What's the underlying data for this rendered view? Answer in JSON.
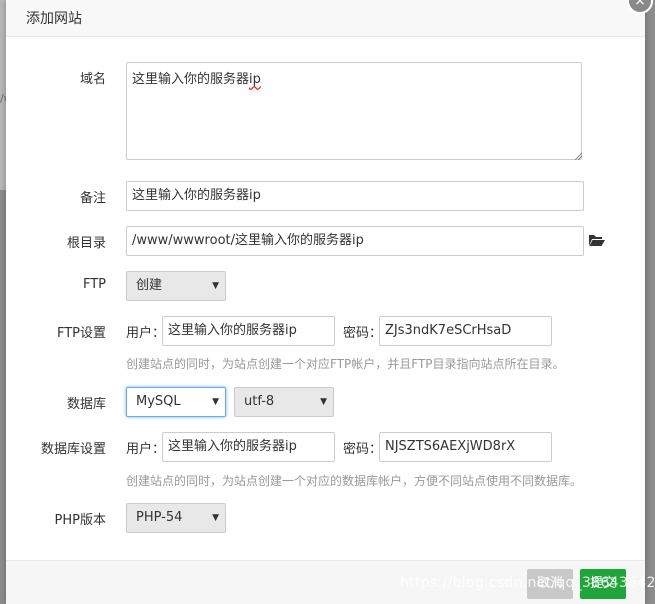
{
  "background": {
    "left_text": "/w"
  },
  "dialog": {
    "title": "添加网站",
    "close_glyph": "×"
  },
  "form": {
    "domain": {
      "label": "域名",
      "value": "这里输入你的服务器",
      "value_flagged": "ip"
    },
    "remark": {
      "label": "备注",
      "value": "这里输入你的服务器ip"
    },
    "root_dir": {
      "label": "根目录",
      "value": "/www/wwwroot/这里输入你的服务器ip"
    },
    "ftp": {
      "label": "FTP",
      "selected": "创建"
    },
    "ftp_settings": {
      "label": "FTP设置",
      "user_label": "用户：",
      "user_value": "这里输入你的服务器ip",
      "password_label": "密码：",
      "password_value": "ZJs3ndK7eSCrHsaD",
      "hint": "创建站点的同时，为站点创建一个对应FTP帐户，并且FTP目录指向站点所在目录。"
    },
    "database": {
      "label": "数据库",
      "type_selected": "MySQL",
      "charset_selected": "utf-8"
    },
    "database_settings": {
      "label": "数据库设置",
      "user_label": "用户：",
      "user_value": "这里输入你的服务器ip",
      "password_label": "密码：",
      "password_value": "NJSZTS6AEXjWD8rX",
      "hint": "创建站点的同时，为站点创建一个对应的数据库帐户，方便不同站点使用不同数据库。"
    },
    "php_version": {
      "label": "PHP版本",
      "selected": "PHP-54"
    }
  },
  "footer": {
    "cancel_label": "取消",
    "submit_label": "提交"
  },
  "watermark": "https://blog.csdn.net/qq_38643642",
  "icons": {
    "select_arrow": "▼",
    "folder": "folder-open-icon",
    "close": "close-icon"
  },
  "colors": {
    "submit": "#20a53a",
    "focus": "#66afe9",
    "hint": "#999999"
  }
}
